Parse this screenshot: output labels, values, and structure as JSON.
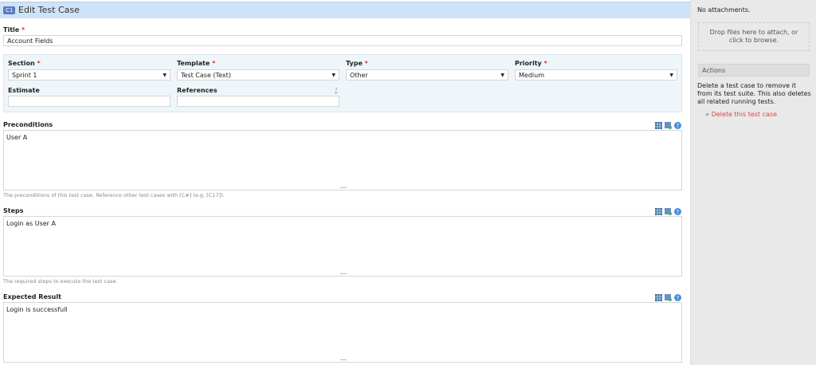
{
  "header": {
    "badge": "C1",
    "title": "Edit Test Case"
  },
  "form": {
    "title": {
      "label": "Title",
      "required": "*",
      "value": "Account Fields"
    },
    "section": {
      "label": "Section",
      "required": "*",
      "value": "Sprint 1"
    },
    "template": {
      "label": "Template",
      "required": "*",
      "value": "Test Case (Text)"
    },
    "type": {
      "label": "Type",
      "required": "*",
      "value": "Other"
    },
    "priority": {
      "label": "Priority",
      "required": "*",
      "value": "Medium"
    },
    "estimate": {
      "label": "Estimate",
      "value": ""
    },
    "references": {
      "label": "References",
      "help": "?",
      "value": ""
    },
    "preconditions": {
      "label": "Preconditions",
      "value": "User A",
      "hint": "The preconditions of this test case. Reference other test cases with [C#] (e.g. [C17])."
    },
    "steps": {
      "label": "Steps",
      "value": "Login as User A",
      "hint": "The required steps to execute the test case."
    },
    "expected": {
      "label": "Expected Result",
      "value": "Login is successfull"
    }
  },
  "sidebar": {
    "no_attachments": "No attachments.",
    "drop_zone": "Drop files here to attach, or click to browse.",
    "actions_header": "Actions",
    "actions_desc": "Delete a test case to remove it from its test suite. This also deletes all related running tests.",
    "delete_prefix": "»",
    "delete_link": "Delete this test case"
  },
  "colors": {
    "header_bg": "#cfe3f8",
    "required": "#dd3333",
    "delete_link": "#dd4444",
    "sidebar_bg": "#e9e9e9"
  }
}
